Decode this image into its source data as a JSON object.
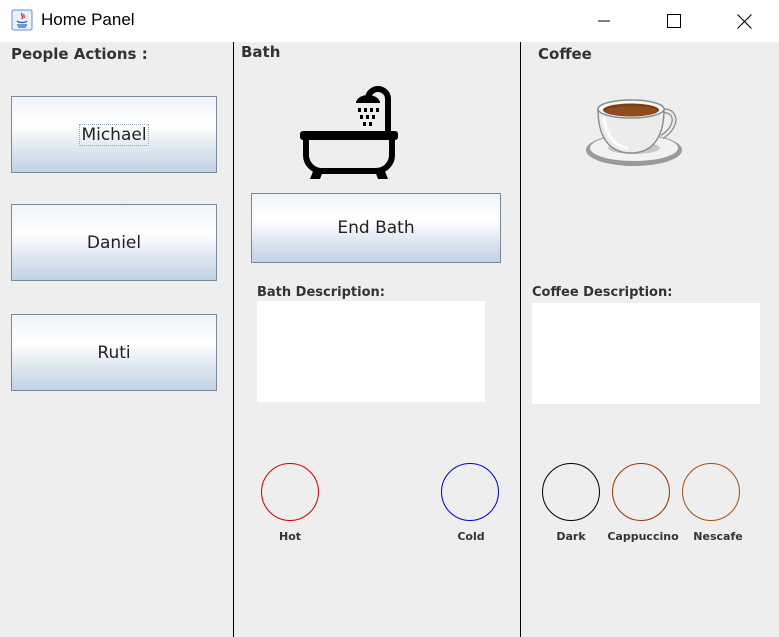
{
  "window": {
    "title": "Home Panel",
    "icon": "java-icon",
    "controls": [
      "minimize-icon",
      "maximize-icon",
      "close-icon"
    ]
  },
  "people": {
    "heading": "People Actions :",
    "buttons": [
      "Michael",
      "Daniel",
      "Ruti"
    ],
    "focused": "Michael"
  },
  "bath": {
    "heading": "Bath",
    "icon": "bathtub-icon",
    "end_button": "End Bath",
    "description_label": "Bath Description:",
    "description_value": "",
    "options": [
      {
        "label": "Hot",
        "color": "#cc0000"
      },
      {
        "label": "Cold",
        "color": "#0000cc"
      }
    ]
  },
  "coffee": {
    "heading": "Coffee",
    "icon": "coffee-cup-icon",
    "description_label": "Coffee Description:",
    "description_value": "",
    "options": [
      {
        "label": "Dark",
        "color": "#000000"
      },
      {
        "label": "Cappuccino",
        "color": "#993300"
      },
      {
        "label": "Nescafe",
        "color": "#a0520c"
      }
    ]
  }
}
